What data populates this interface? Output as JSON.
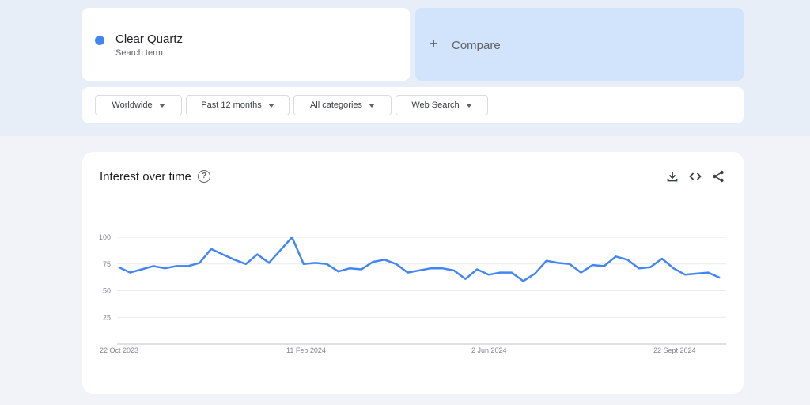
{
  "search_term": {
    "title": "Clear Quartz",
    "subtitle": "Search term",
    "color": "#4285f4"
  },
  "compare": {
    "plus": "+",
    "label": "Compare"
  },
  "filters": [
    {
      "label": "Worldwide"
    },
    {
      "label": "Past 12 months"
    },
    {
      "label": "All categories"
    },
    {
      "label": "Web Search"
    }
  ],
  "chart_header": {
    "title": "Interest over time",
    "help_glyph": "?",
    "tools": [
      "download-icon",
      "embed-icon",
      "share-icon"
    ]
  },
  "chart_data": {
    "type": "line",
    "title": "",
    "xlabel": "",
    "ylabel": "",
    "ylim": [
      0,
      100
    ],
    "y_ticks": [
      25,
      50,
      75,
      100
    ],
    "x_tick_labels": [
      "22 Oct 2023",
      "11 Feb 2024",
      "2 Jun 2024",
      "22 Sept 2024"
    ],
    "grid": true,
    "line_color": "#4285f4",
    "series": [
      {
        "values": [
          72,
          67,
          70,
          73,
          71,
          73,
          73,
          76,
          89,
          84,
          79,
          75,
          84,
          76,
          88,
          100,
          75,
          76,
          75,
          68,
          71,
          70,
          77,
          79,
          75,
          67,
          69,
          71,
          71,
          69,
          61,
          70,
          65,
          67,
          67,
          59,
          66,
          78,
          76,
          75,
          67,
          74,
          73,
          82,
          79,
          71,
          72,
          80,
          71,
          65,
          66,
          67,
          62
        ]
      }
    ]
  }
}
